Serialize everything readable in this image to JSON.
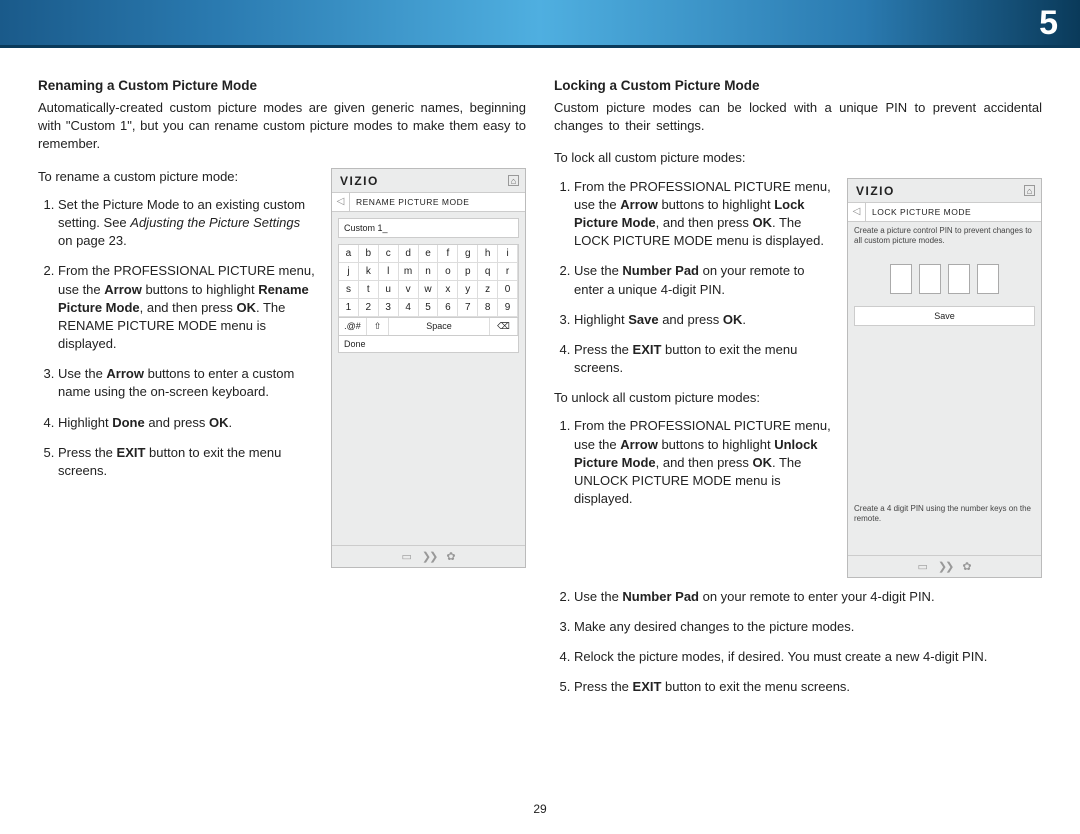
{
  "header": {
    "chapter": "5"
  },
  "page_number": "29",
  "left": {
    "title": "Renaming a Custom Picture Mode",
    "intro": "Automatically-created custom picture modes are given generic names, beginning with \"Custom 1\", but you can rename custom picture modes to make them easy to remember.",
    "lead_in": "To rename a custom picture mode:",
    "steps": {
      "s1a": "Set the Picture Mode to an existing custom setting. See ",
      "s1_i": "Adjusting the Picture Settings",
      "s1b": " on page 23.",
      "s2a": "From the PROFESSIONAL PICTURE menu, use the ",
      "s2_b1": "Arrow",
      "s2b": " buttons to highlight ",
      "s2_b2": "Rename Picture Mode",
      "s2c": ", and then press ",
      "s2_b3": "OK",
      "s2d": ". The RENAME PICTURE MODE menu is displayed.",
      "s3a": "Use the ",
      "s3_b1": "Arrow",
      "s3b": " buttons to enter a custom name using the on-screen keyboard.",
      "s4a": "Highlight ",
      "s4_b1": "Done",
      "s4b": " and press ",
      "s4_b2": "OK",
      "s4c": ".",
      "s5a": "Press the ",
      "s5_b1": "EXIT",
      "s5b": " button to exit the menu screens."
    }
  },
  "right": {
    "title": "Locking a Custom Picture Mode",
    "intro": "Custom picture modes can be locked with a unique PIN to prevent accidental changes to their settings.",
    "lock_lead": "To lock all custom picture modes:",
    "lock_steps": {
      "s1a": "From the PROFESSIONAL PICTURE menu, use the ",
      "s1_b1": "Arrow",
      "s1b": " buttons to highlight ",
      "s1_b2": "Lock Picture Mode",
      "s1c": ", and then press ",
      "s1_b3": "OK",
      "s1d": ". The LOCK PICTURE MODE menu is displayed.",
      "s2a": "Use the ",
      "s2_b1": "Number Pad",
      "s2b": " on your remote to enter a unique 4-digit PIN.",
      "s3a": "Highlight ",
      "s3_b1": "Save",
      "s3b": " and press ",
      "s3_b2": "OK",
      "s3c": ".",
      "s4a": "Press the ",
      "s4_b1": "EXIT",
      "s4b": " button to exit the menu screens."
    },
    "unlock_lead": "To unlock all custom picture modes:",
    "unlock_steps": {
      "s1a": "From the PROFESSIONAL PICTURE menu, use the ",
      "s1_b1": "Arrow",
      "s1b": " buttons to highlight ",
      "s1_b2": "Unlock Picture Mode",
      "s1c": ", and then press ",
      "s1_b3": "OK",
      "s1d": ". The UNLOCK PICTURE MODE menu is displayed.",
      "s2a": "Use the ",
      "s2_b1": "Number Pad",
      "s2b": " on your remote to enter your 4-digit PIN.",
      "s3": "Make any desired changes to the picture modes.",
      "s4": "Relock the picture modes, if desired. You must create a new 4-digit PIN.",
      "s5a": "Press the ",
      "s5_b1": "EXIT",
      "s5b": " button to exit the menu screens."
    }
  },
  "tv_rename": {
    "brand": "VIZIO",
    "home_glyph": "⌂",
    "back_glyph": "◁",
    "subtitle": "RENAME PICTURE MODE",
    "preview": "Custom 1_",
    "keys": [
      "a",
      "b",
      "c",
      "d",
      "e",
      "f",
      "g",
      "h",
      "i",
      "j",
      "k",
      "l",
      "m",
      "n",
      "o",
      "p",
      "q",
      "r",
      "s",
      "t",
      "u",
      "v",
      "w",
      "x",
      "y",
      "z",
      "0",
      "1",
      "2",
      "3",
      "4",
      "5",
      "6",
      "7",
      "8",
      "9"
    ],
    "sym": ".@#",
    "shift": "⇧",
    "space": "Space",
    "bksp": "⌫",
    "done": "Done",
    "btm1": "▭",
    "btm2": "❯❯",
    "btm3": "✿"
  },
  "tv_lock": {
    "brand": "VIZIO",
    "home_glyph": "⌂",
    "back_glyph": "◁",
    "subtitle": "LOCK PICTURE MODE",
    "desc": "Create a picture control PIN to prevent changes to all custom picture modes.",
    "save": "Save",
    "hint": "Create a 4 digit PIN using the number keys on the remote.",
    "btm1": "▭",
    "btm2": "❯❯",
    "btm3": "✿"
  }
}
